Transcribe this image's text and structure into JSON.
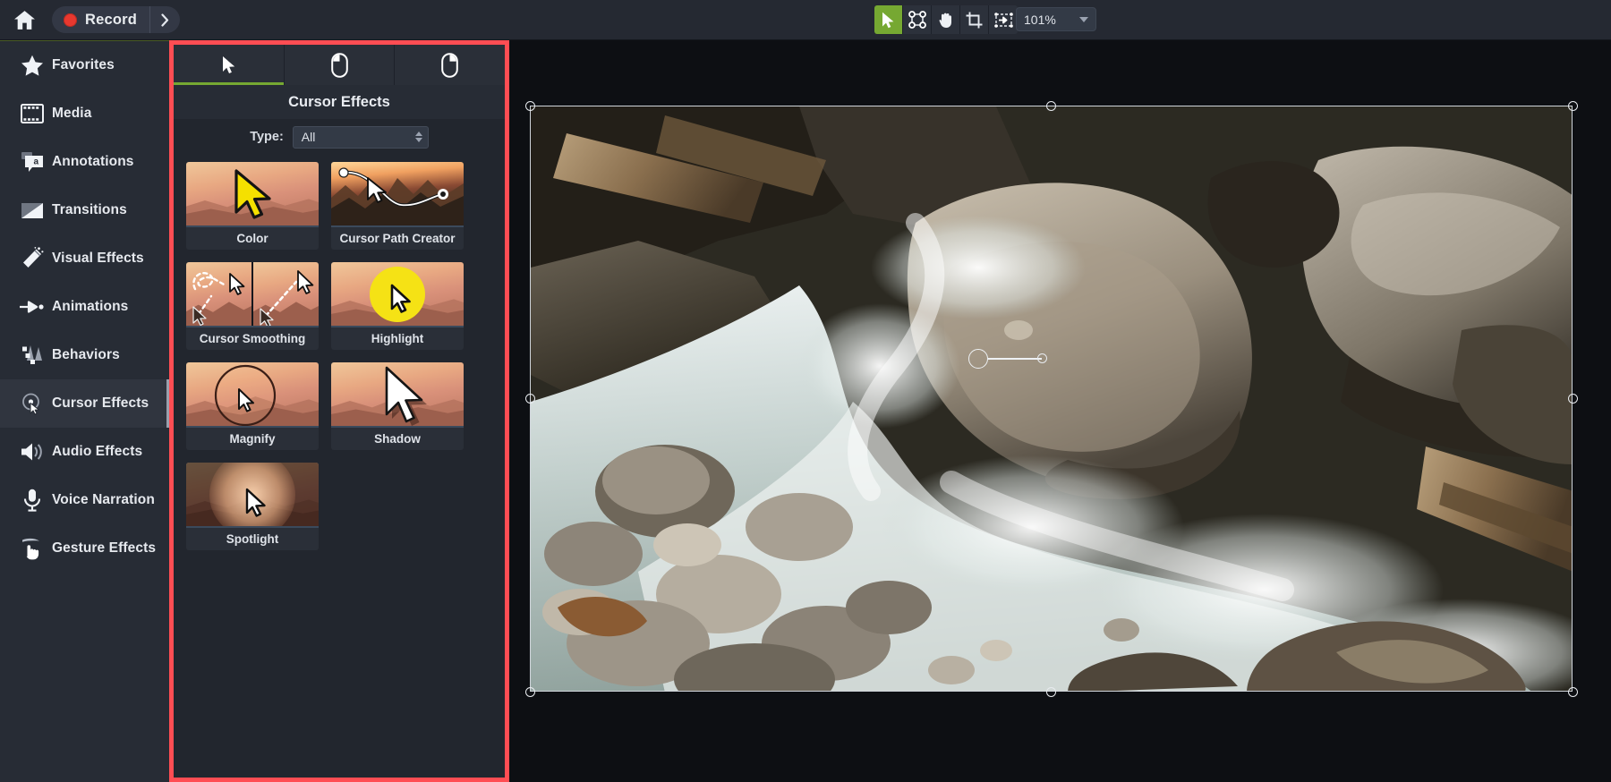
{
  "topbar": {
    "home_icon": "home-icon",
    "record_label": "Record",
    "record_dot_icon": "record-dot-icon",
    "record_more_icon": "chevron-right-icon",
    "tools": [
      {
        "name": "select-tool",
        "icon": "cursor-arrow-icon",
        "active": true
      },
      {
        "name": "edit-points-tool",
        "icon": "anchor-points-icon",
        "active": false
      },
      {
        "name": "hand-tool",
        "icon": "hand-icon",
        "active": false
      },
      {
        "name": "crop-tool",
        "icon": "crop-icon",
        "active": false
      },
      {
        "name": "transition-tool",
        "icon": "move-frame-icon",
        "active": false
      }
    ],
    "zoom_value": "101%",
    "zoom_caret_icon": "chevron-down-icon",
    "accent_green": "#76a832",
    "record_red": "#e8382f"
  },
  "sidebar": {
    "items": [
      {
        "label": "Favorites",
        "icon": "star-icon",
        "active": false
      },
      {
        "label": "Media",
        "icon": "filmstrip-icon",
        "active": false
      },
      {
        "label": "Annotations",
        "icon": "callout-a-icon",
        "active": false
      },
      {
        "label": "Transitions",
        "icon": "gradient-box-icon",
        "active": false
      },
      {
        "label": "Visual Effects",
        "icon": "magic-wand-icon",
        "active": false
      },
      {
        "label": "Animations",
        "icon": "arrow-keyframe-icon",
        "active": false
      },
      {
        "label": "Behaviors",
        "icon": "behaviors-icon",
        "active": false
      },
      {
        "label": "Cursor Effects",
        "icon": "cursor-target-icon",
        "active": true
      },
      {
        "label": "Audio Effects",
        "icon": "speaker-icon",
        "active": false
      },
      {
        "label": "Voice Narration",
        "icon": "microphone-icon",
        "active": false
      },
      {
        "label": "Gesture Effects",
        "icon": "hand-tap-icon",
        "active": false
      }
    ]
  },
  "panel": {
    "highlight_border_color": "#ff4d53",
    "tabs": [
      {
        "name": "tab-cursor",
        "icon": "cursor-arrow-icon",
        "active": true
      },
      {
        "name": "tab-left-click",
        "icon": "mouse-left-click-icon",
        "active": false
      },
      {
        "name": "tab-right-click",
        "icon": "mouse-right-click-icon",
        "active": false
      }
    ],
    "title": "Cursor Effects",
    "type_label": "Type:",
    "type_value": "All",
    "type_spinner_icon": "spinner-updown-icon",
    "effects": [
      {
        "label": "Color",
        "thumb": "cursor-yellow-thumb"
      },
      {
        "label": "Cursor Path Creator",
        "thumb": "path-bezier-thumb"
      },
      {
        "label": "Cursor Smoothing",
        "thumb": "smoothing-split-thumb"
      },
      {
        "label": "Highlight",
        "thumb": "yellow-circle-thumb"
      },
      {
        "label": "Magnify",
        "thumb": "magnify-ring-thumb"
      },
      {
        "label": "Shadow",
        "thumb": "cursor-shadow-thumb"
      },
      {
        "label": "Spotlight",
        "thumb": "spotlight-glow-thumb"
      }
    ]
  },
  "canvas": {
    "media_name": "rocky-stream-photo",
    "selection_handles_icon": "resize-handle-icon",
    "rotation_handle_icon": "rotation-handle-icon"
  }
}
